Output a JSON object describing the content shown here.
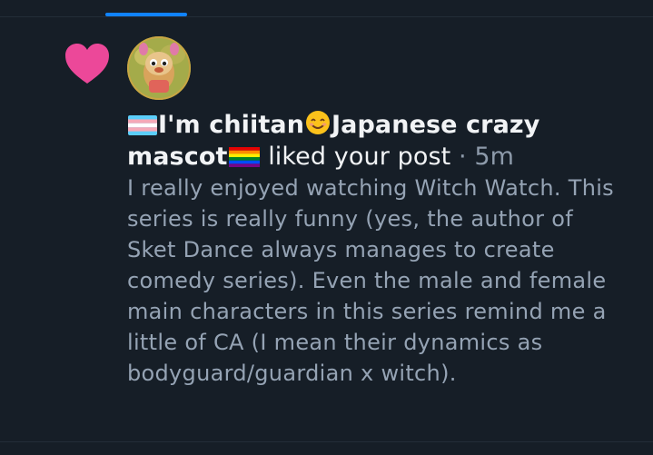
{
  "notification": {
    "author_name_before": "I'm chiitan",
    "author_name_middle": "Japanese crazy mascot",
    "action": "liked your post",
    "separator": "·",
    "timestamp": "5m",
    "post_text": "I really enjoyed watching Witch Watch. This series is really funny (yes, the author of Sket Dance always manages to create comedy series). Even the male and female main characters in this series remind me a little of CA (I mean their dynamics as bodyguard/guardian x witch).",
    "notification_type_icon": "heart-icon",
    "emojis": [
      "transgender-flag",
      "smiling-face",
      "rainbow-flag"
    ]
  },
  "colors": {
    "background": "#161e27",
    "heart": "#ec4899",
    "tab_accent": "#1083fe",
    "primary_text": "#f1f3f5",
    "secondary_text": "#95a3b4"
  }
}
